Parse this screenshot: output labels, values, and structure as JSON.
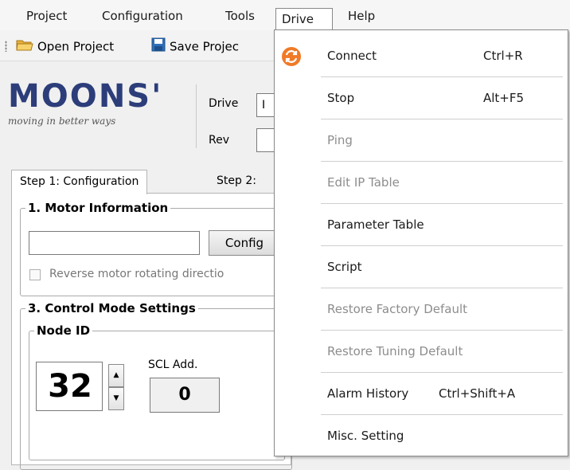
{
  "menubar": {
    "items": [
      {
        "label": "Project"
      },
      {
        "label": "Configuration"
      },
      {
        "label": "Tools"
      },
      {
        "label": "Drive"
      },
      {
        "label": "Help"
      }
    ]
  },
  "toolbar": {
    "open_label": "Open Project",
    "save_label": "Save Projec"
  },
  "brand": {
    "logo_word": "MOONS'",
    "logo_tagline": "moving in better ways",
    "drive_label": "Drive",
    "drive_value": "I",
    "rev_label": "Rev",
    "rev_value": ""
  },
  "tabs": [
    {
      "label": "Step 1: Configuration"
    },
    {
      "label": "Step 2:"
    }
  ],
  "motor": {
    "title": "1.  Motor Information",
    "config_button": "Config",
    "reverse_label": "Reverse motor rotating directio"
  },
  "control": {
    "title": "3. Control Mode Settings",
    "node_title": "Node ID",
    "node_value": "32",
    "scl_label": "SCL Add.",
    "scl_value": "0"
  },
  "drive_menu": {
    "items": [
      {
        "label": "Connect",
        "shortcut": "Ctrl+R",
        "enabled": true,
        "icon": "refresh-icon"
      },
      {
        "label": "Stop",
        "shortcut": "Alt+F5",
        "enabled": true
      },
      {
        "label": "Ping",
        "shortcut": "",
        "enabled": false
      },
      {
        "label": "Edit IP Table",
        "shortcut": "",
        "enabled": false
      },
      {
        "label": "Parameter Table",
        "shortcut": "",
        "enabled": true
      },
      {
        "label": "Script",
        "shortcut": "",
        "enabled": true
      },
      {
        "label": "Restore Factory Default",
        "shortcut": "",
        "enabled": false
      },
      {
        "label": "Restore Tuning Default",
        "shortcut": "",
        "enabled": false
      },
      {
        "label": "Alarm History",
        "shortcut": "Ctrl+Shift+A",
        "enabled": true
      },
      {
        "label": "Misc. Setting",
        "shortcut": "",
        "enabled": true
      }
    ]
  },
  "colors": {
    "logo_blue": "#2c3d7a",
    "icon_orange": "#f07a28",
    "disabled_text": "#8d8d8d"
  }
}
